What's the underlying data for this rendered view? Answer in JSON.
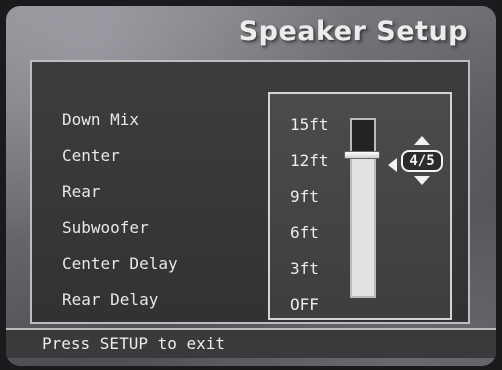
{
  "title": "Speaker Setup",
  "menu": {
    "items": [
      {
        "label": "Down Mix"
      },
      {
        "label": "Center"
      },
      {
        "label": "Rear"
      },
      {
        "label": "Subwoofer"
      },
      {
        "label": "Center Delay"
      },
      {
        "label": "Rear Delay"
      }
    ]
  },
  "slider": {
    "scale_labels": [
      "15ft",
      "12ft",
      "9ft",
      "6ft",
      "3ft",
      "OFF"
    ],
    "value": "4/5",
    "level_fraction": 0.8
  },
  "footer": {
    "hint": "Press SETUP to exit"
  },
  "colors": {
    "panel_bg": "#3a3a3c",
    "text": "#ececec",
    "border": "#bdbdbd"
  }
}
